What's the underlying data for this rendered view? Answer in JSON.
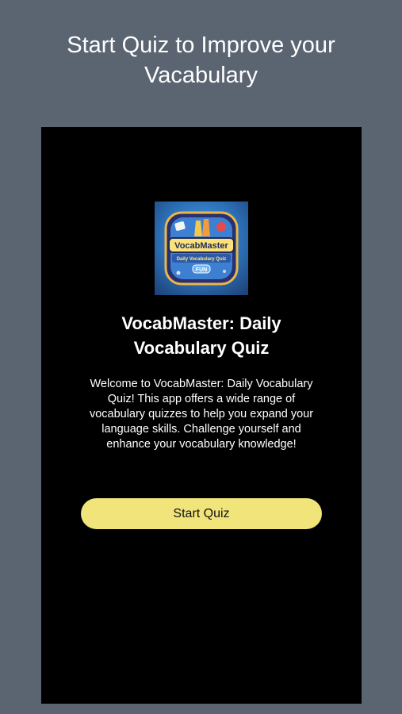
{
  "promo": {
    "title_line1": "Start Quiz to Improve your",
    "title_line2": "Vacabulary"
  },
  "app": {
    "icon": "vocabmaster-logo",
    "icon_text": "VocabMaster",
    "icon_subtext": "Daily Vocabulary Quiz",
    "icon_badge": "FUN",
    "name_line1": "VocabMaster: Daily",
    "name_line2": "Vocabulary Quiz",
    "description": "Welcome to VocabMaster: Daily Vocabulary Quiz! This app offers a wide range of vocabulary quizzes to help you expand your language skills. Challenge yourself and enhance your vocabulary knowledge!",
    "start_button_label": "Start Quiz"
  },
  "colors": {
    "page_background": "#5b6572",
    "screen_background": "#000000",
    "button_background": "#f0e47a",
    "text_primary": "#ffffff"
  }
}
